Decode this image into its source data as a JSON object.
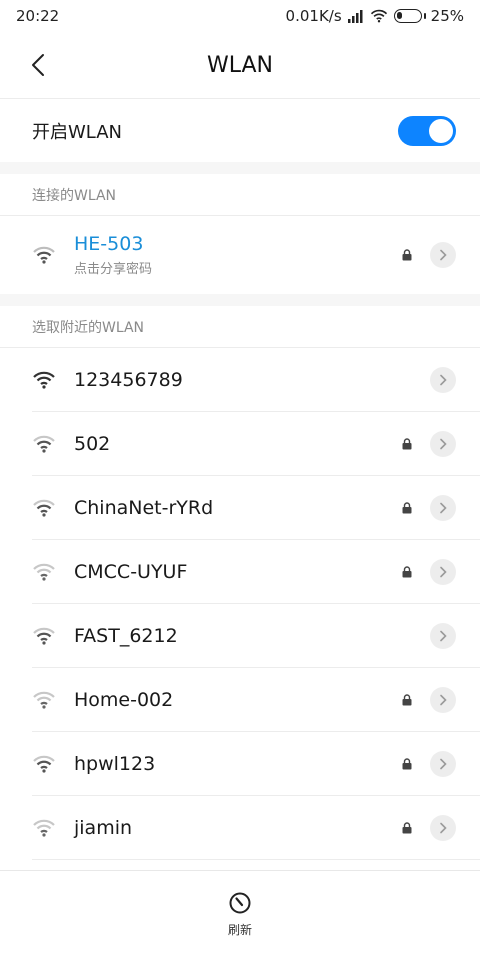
{
  "status_bar": {
    "time": "20:22",
    "net_speed": "0.01K/s",
    "battery_pct": "25%",
    "battery_level": 0.25
  },
  "header": {
    "title": "WLAN",
    "back_icon": "chevron-left-icon"
  },
  "toggle": {
    "label": "开启WLAN",
    "on": true,
    "accent": "#0d84ff"
  },
  "connected_section": {
    "title": "连接的WLAN",
    "network": {
      "name": "HE-503",
      "subtitle": "点击分享密码",
      "locked": true,
      "color": "#1a8ed8"
    }
  },
  "nearby_section": {
    "title": "选取附近的WLAN",
    "networks": [
      {
        "name": "123456789",
        "locked": false,
        "signal": "strong"
      },
      {
        "name": "502",
        "locked": true,
        "signal": "medium"
      },
      {
        "name": "ChinaNet-rYRd",
        "locked": true,
        "signal": "medium"
      },
      {
        "name": "CMCC-UYUF",
        "locked": true,
        "signal": "weak"
      },
      {
        "name": "FAST_6212",
        "locked": false,
        "signal": "medium"
      },
      {
        "name": "Home-002",
        "locked": true,
        "signal": "weak"
      },
      {
        "name": "hpwl123",
        "locked": true,
        "signal": "medium"
      },
      {
        "name": "jiamin",
        "locked": true,
        "signal": "weak"
      }
    ]
  },
  "bottom_bar": {
    "refresh_label": "刷新",
    "refresh_icon": "refresh-icon"
  }
}
